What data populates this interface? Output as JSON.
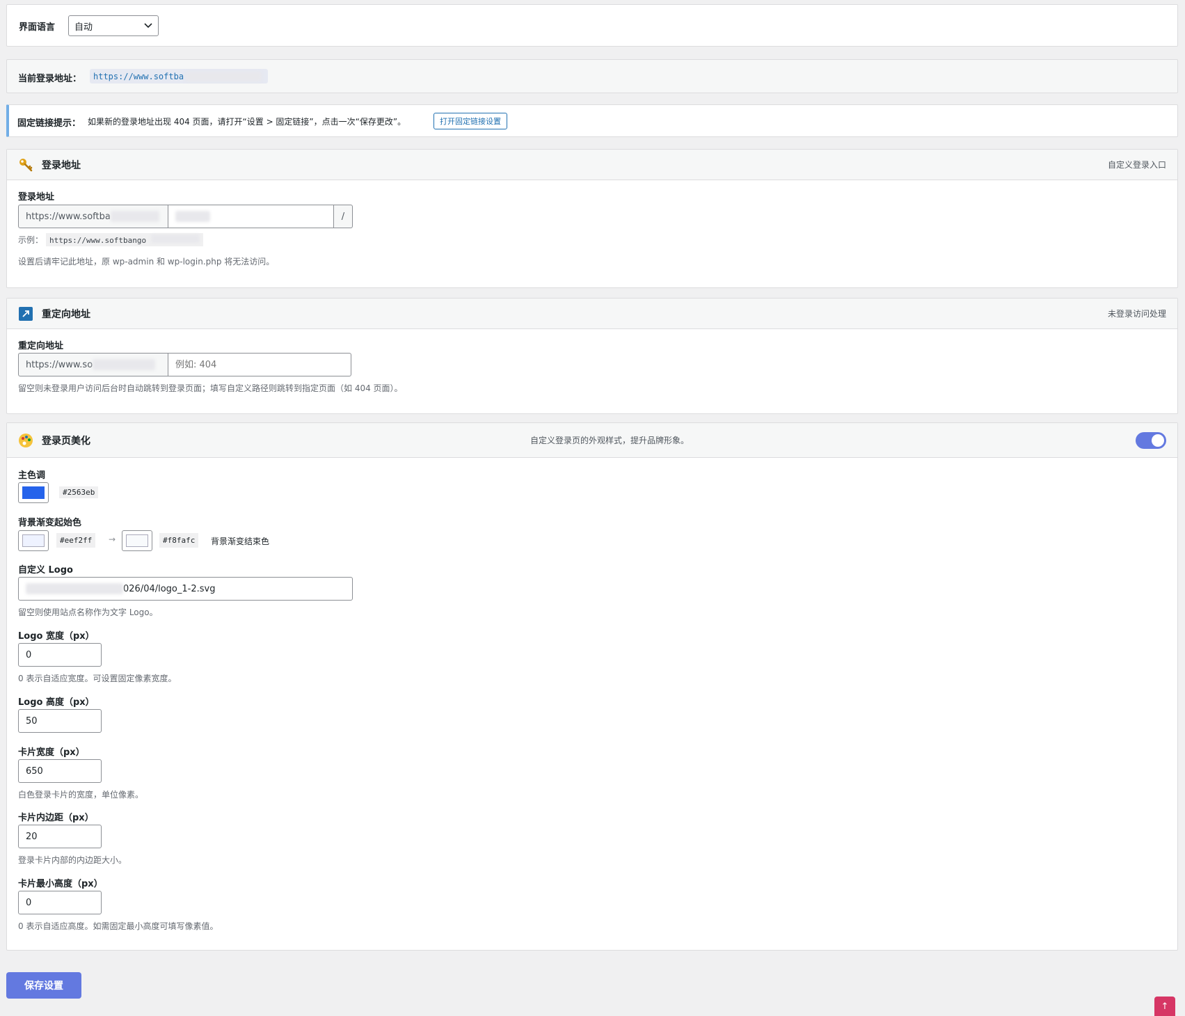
{
  "language": {
    "label": "界面语言",
    "value": "自动"
  },
  "current_login": {
    "label": "当前登录地址：",
    "url": "https://www.softba"
  },
  "permalink_tip": {
    "label": "固定链接提示：",
    "text": "如果新的登录地址出现 404 页面，请打开“设置 > 固定链接”，点击一次“保存更改”。",
    "button": "打开固定链接设置"
  },
  "login_section": {
    "title": "登录地址",
    "right": "自定义登录入口",
    "field_label": "登录地址",
    "prefix": "https://www.softba",
    "suffix": "/",
    "example_label": "示例：",
    "example_value": "https://www.softbango",
    "hint": "设置后请牢记此地址，原 wp-admin 和 wp-login.php 将无法访问。"
  },
  "redirect_section": {
    "title": "重定向地址",
    "right": "未登录访问处理",
    "field_label": "重定向地址",
    "prefix": "https://www.so",
    "placeholder": "例如: 404",
    "hint": "留空则未登录用户访问后台时自动跳转到登录页面；填写自定义路径则跳转到指定页面（如 404 页面）。"
  },
  "beauty_section": {
    "title": "登录页美化",
    "center": "自定义登录页的外观样式，提升品牌形象。",
    "toggle_on": true,
    "primary_label": "主色调",
    "primary_color": "#2563eb",
    "bg_start_label": "背景渐变起始色",
    "bg_start": "#eef2ff",
    "arrow": "→",
    "bg_end": "#f8fafc",
    "bg_end_label": "背景渐变结束色",
    "logo_label": "自定义 Logo",
    "logo_value": "026/04/logo_1-2.svg",
    "logo_hint": "留空则使用站点名称作为文字 Logo。",
    "logo_width_label": "Logo 宽度（px）",
    "logo_width": "0",
    "logo_width_hint": "0 表示自适应宽度。可设置固定像素宽度。",
    "logo_height_label": "Logo 高度（px）",
    "logo_height": "50",
    "card_width_label": "卡片宽度（px）",
    "card_width": "650",
    "card_width_hint": "白色登录卡片的宽度，单位像素。",
    "card_padding_label": "卡片内边距（px）",
    "card_padding": "20",
    "card_padding_hint": "登录卡片内部的内边距大小。",
    "card_min_height_label": "卡片最小高度（px）",
    "card_min_height": "0",
    "card_min_height_hint": "0 表示自适应高度。如需固定最小高度可填写像素值。"
  },
  "save_button": "保存设置",
  "scroll_top": "↑"
}
